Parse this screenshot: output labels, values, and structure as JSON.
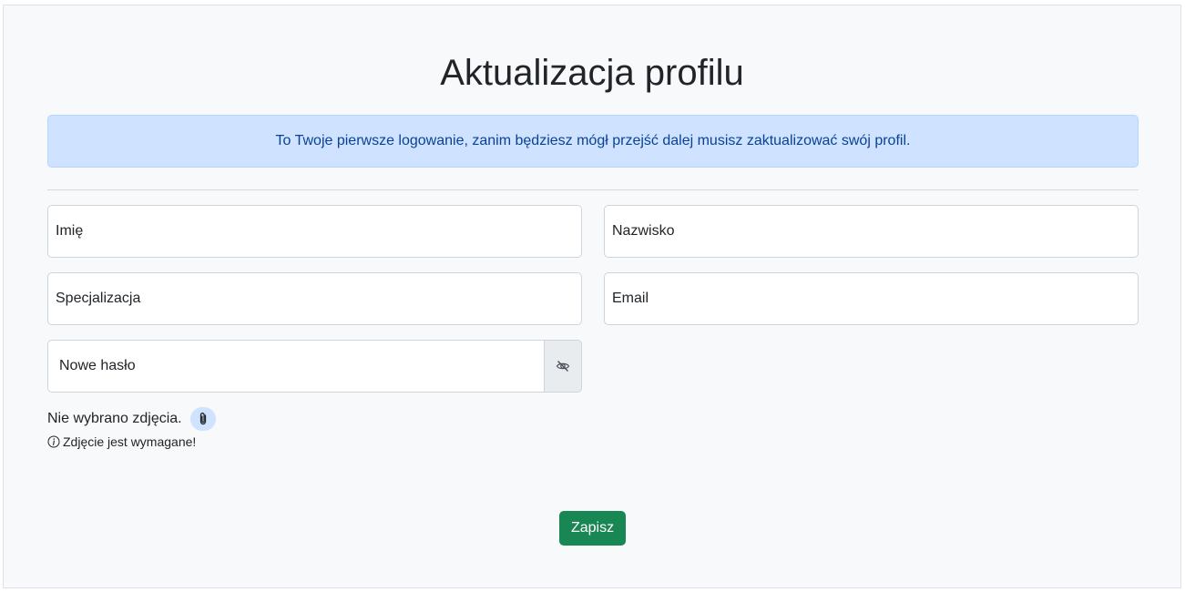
{
  "page": {
    "title": "Aktualizacja profilu"
  },
  "alert": {
    "message": "To Twoje pierwsze logowanie, zanim będziesz mógł przejść dalej musisz zaktualizować swój profil."
  },
  "form": {
    "first_name_placeholder": "Imię",
    "last_name_placeholder": "Nazwisko",
    "specialization_placeholder": "Specjalizacja",
    "email_placeholder": "Email",
    "new_password_placeholder": "Nowe hasło",
    "password_toggle_icon": "eye-slash-icon",
    "photo_status": "Nie wybrano zdjęcia.",
    "photo_attach_icon": "paperclip-icon",
    "photo_hint_icon": "info-circle-icon",
    "photo_hint": "Zdjęcie jest wymagane!",
    "save_label": "Zapisz"
  },
  "colors": {
    "background": "#f8f9fa",
    "alert_bg": "#cfe2ff",
    "alert_text": "#084298",
    "save_button": "#198754"
  }
}
